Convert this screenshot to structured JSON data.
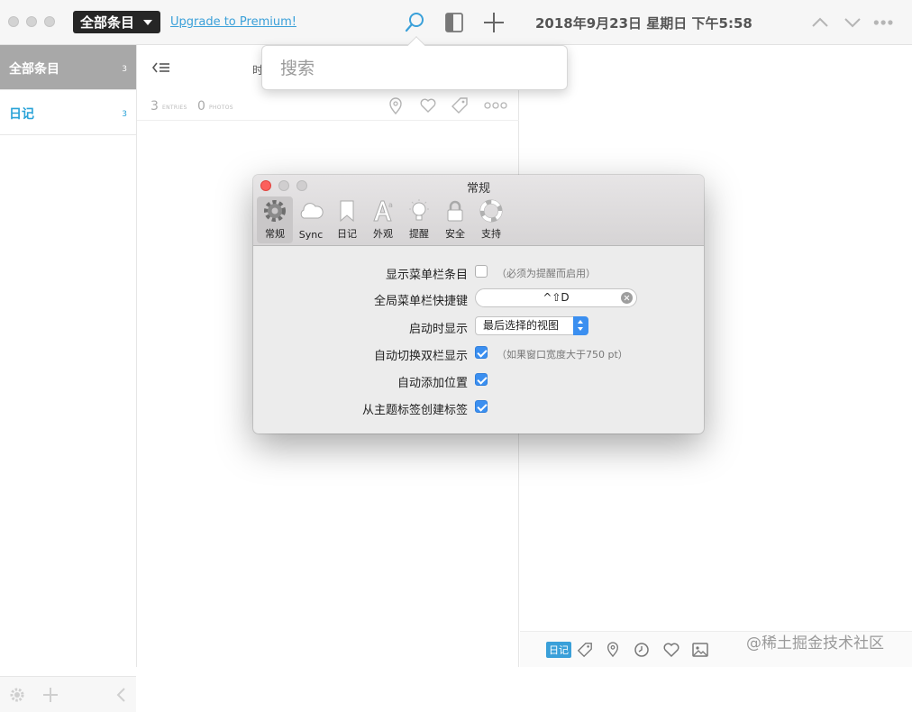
{
  "titlebar": {
    "filter_label": "全部条目",
    "upgrade_link": "Upgrade to Premium!",
    "datetime": "2018年9月23日 星期日 下午5:58"
  },
  "sidebar": {
    "items": [
      {
        "label": "全部条目",
        "count": "3"
      },
      {
        "label": "日记",
        "count": "3"
      }
    ]
  },
  "entrylist": {
    "header_partial": "时",
    "entries_count": "3",
    "entries_label": "ENTRIES",
    "photos_count": "0",
    "photos_label": "PHOTOS"
  },
  "search": {
    "placeholder": "搜索"
  },
  "prefs": {
    "title": "常规",
    "tabs": [
      {
        "label": "常规",
        "icon": "gear-icon",
        "active": true
      },
      {
        "label": "Sync",
        "icon": "cloud-icon"
      },
      {
        "label": "日记",
        "icon": "bookmark-icon"
      },
      {
        "label": "外观",
        "icon": "font-icon"
      },
      {
        "label": "提醒",
        "icon": "lightbulb-icon"
      },
      {
        "label": "安全",
        "icon": "lock-icon"
      },
      {
        "label": "支持",
        "icon": "lifebuoy-icon"
      }
    ],
    "rows": {
      "menubar_label": "显示菜单栏条目",
      "menubar_hint": "（必须为提醒而启用）",
      "shortcut_label": "全局菜单栏快捷键",
      "shortcut_value": "^⇧D",
      "startup_label": "启动时显示",
      "startup_value": "最后选择的视图",
      "dualpane_label": "自动切换双栏显示",
      "dualpane_hint": "（如果窗口宽度大于750 pt）",
      "location_label": "自动添加位置",
      "tags_label": "从主题标签创建标签"
    }
  },
  "bottom_toolbar": {
    "journal_chip": "日记"
  },
  "watermark": "@稀土掘金技术社区",
  "colors": {
    "accent": "#2aa3d8",
    "checkbox_on": "#3b8ff0",
    "sidebar_selected": "#a8a8a8",
    "close_red": "#fc605c"
  }
}
